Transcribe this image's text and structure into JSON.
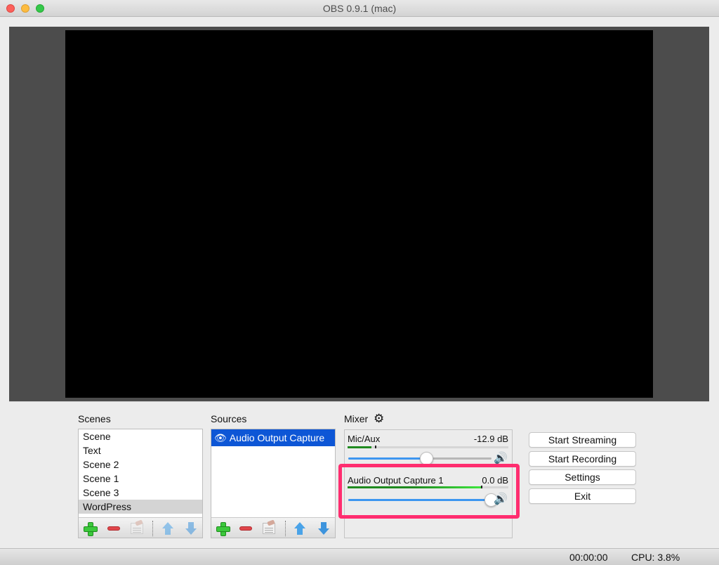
{
  "window": {
    "title": "OBS 0.9.1 (mac)"
  },
  "scenes": {
    "label": "Scenes",
    "items": [
      {
        "label": "Scene",
        "selected": false
      },
      {
        "label": "Text",
        "selected": false
      },
      {
        "label": "Scene 2",
        "selected": false
      },
      {
        "label": "Scene 1",
        "selected": false
      },
      {
        "label": "Scene 3",
        "selected": false
      },
      {
        "label": "WordPress",
        "selected": true
      }
    ],
    "toolbar": [
      "add-icon",
      "remove-icon",
      "properties-icon",
      "move-up-icon",
      "move-down-icon"
    ]
  },
  "sources": {
    "label": "Sources",
    "items": [
      {
        "label": "Audio Output Capture",
        "visible_icon": "eye-icon",
        "selected": true
      }
    ],
    "toolbar": [
      "add-icon",
      "remove-icon",
      "properties-icon",
      "move-up-icon",
      "move-down-icon"
    ]
  },
  "mixer": {
    "label": "Mixer",
    "settings_icon": "gear-icon",
    "channels": [
      {
        "name": "Mic/Aux",
        "db": "-12.9 dB",
        "meter_level": 0.15,
        "peak": 0.17,
        "volume": 0.55,
        "highlighted": false
      },
      {
        "name": "Audio Output Capture 1",
        "db": "0.0 dB",
        "meter_level": 0.83,
        "peak": 0.83,
        "volume": 1.0,
        "highlighted": true
      }
    ],
    "highlight_color": "#ff2d6f"
  },
  "controls": {
    "start_streaming": "Start Streaming",
    "start_recording": "Start Recording",
    "settings": "Settings",
    "exit": "Exit"
  },
  "status": {
    "time": "00:00:00",
    "cpu": "CPU: 3.8%"
  }
}
